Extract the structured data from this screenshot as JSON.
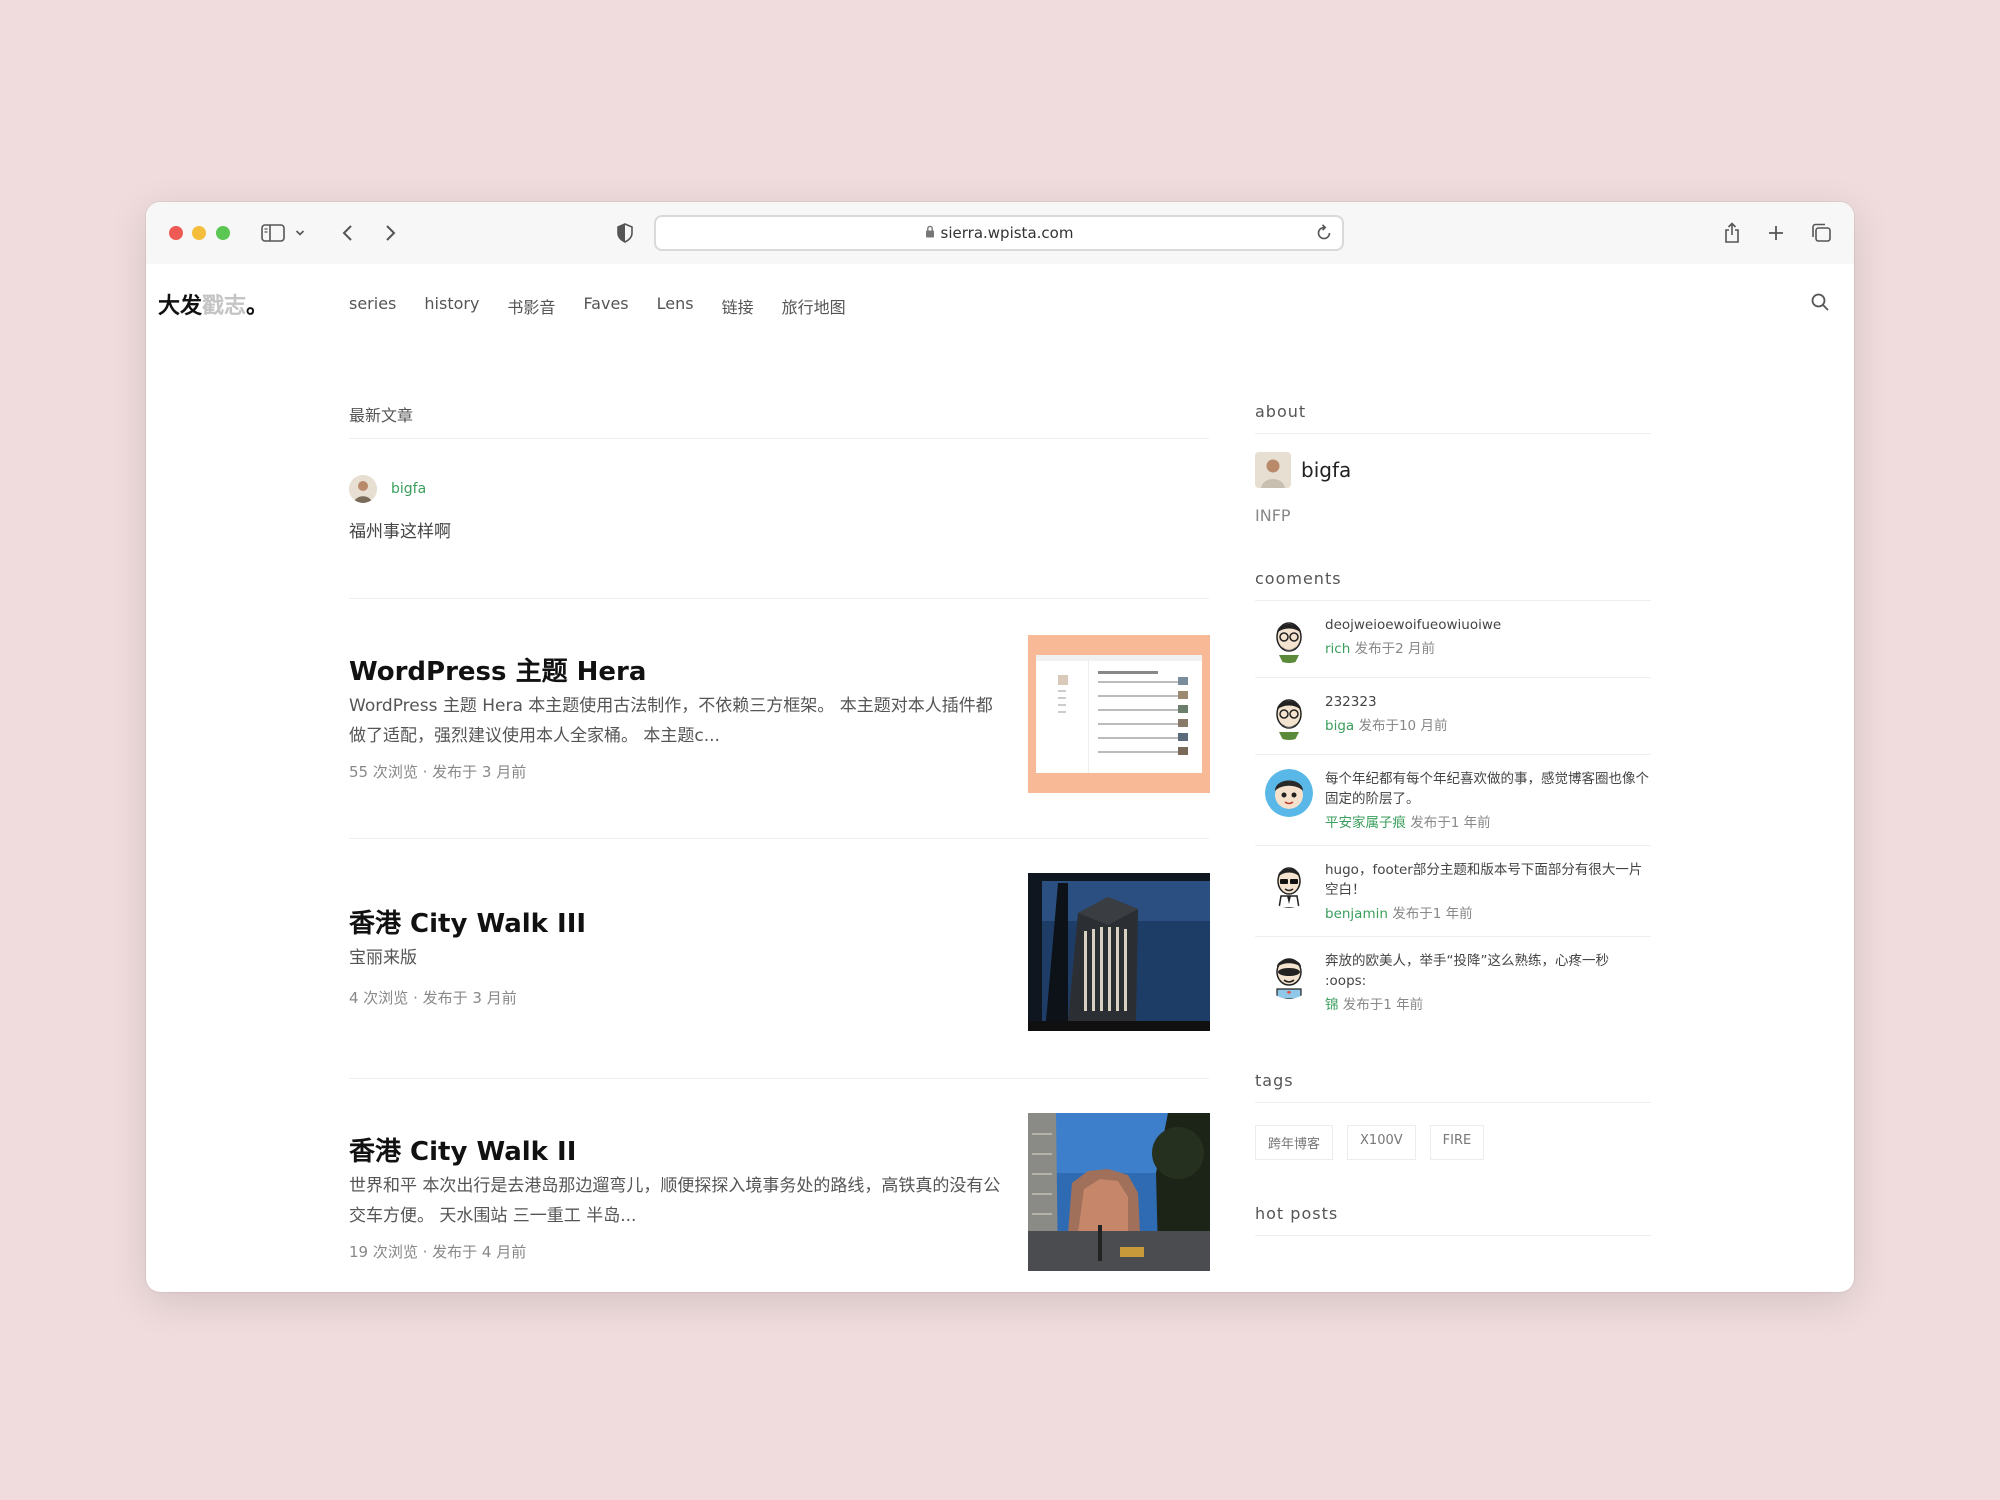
{
  "browser": {
    "url": "sierra.wpista.com"
  },
  "site": {
    "logo_dark": "大发",
    "logo_light": "戳志",
    "logo_mark": "。",
    "nav": [
      "series",
      "history",
      "书影音",
      "Faves",
      "Lens",
      "链接",
      "旅行地图"
    ]
  },
  "main": {
    "section_title": "最新文章",
    "status": {
      "author": "bigfa",
      "text": "福州事这样啊"
    },
    "posts": [
      {
        "title": "WordPress 主题 Hera",
        "excerpt": "WordPress 主题 Hera 本主题使用古法制作，不依赖三方框架。 本主题对本人插件都做了适配，强烈建议使用本人全家桶。 本主题c...",
        "meta": "55 次浏览 · 发布于 3 月前"
      },
      {
        "title": "香港 City Walk III",
        "excerpt": "宝丽来版",
        "meta": "4 次浏览 · 发布于 3 月前"
      },
      {
        "title": "香港 City Walk II",
        "excerpt": "世界和平 本次出行是去港岛那边遛弯儿，顺便探探入境事务处的路线，高铁真的没有公交车方便。 天水围站 三一重工 半岛...",
        "meta": "19 次浏览 · 发布于 4 月前"
      }
    ]
  },
  "sidebar": {
    "about_title": "about",
    "about_name": "bigfa",
    "about_desc": "INFP",
    "comments_title": "cooments",
    "comments": [
      {
        "text": "deojweioewoifueowiuoiwe",
        "author": "rich",
        "time": "发布于2 月前"
      },
      {
        "text": "232323",
        "author": "biga",
        "time": "发布于10 月前"
      },
      {
        "text": "每个年纪都有每个年纪喜欢做的事，感觉博客圈也像个固定的阶层了。",
        "author": "平安家属子痕",
        "time": "发布于1 年前"
      },
      {
        "text": "hugo，footer部分主题和版本号下面部分有很大一片空白！",
        "author": "benjamin",
        "time": "发布于1 年前"
      },
      {
        "text": "奔放的欧美人，举手“投降”这么熟练，心疼一秒 :oops:",
        "author": "锦",
        "time": "发布于1 年前"
      }
    ],
    "tags_title": "tags",
    "tags": [
      "跨年博客",
      "X100V",
      "FIRE"
    ],
    "hot_title": "hot posts"
  },
  "colors": {
    "accent_green": "#3a9e5c",
    "page_background": "#f0dcdd"
  }
}
